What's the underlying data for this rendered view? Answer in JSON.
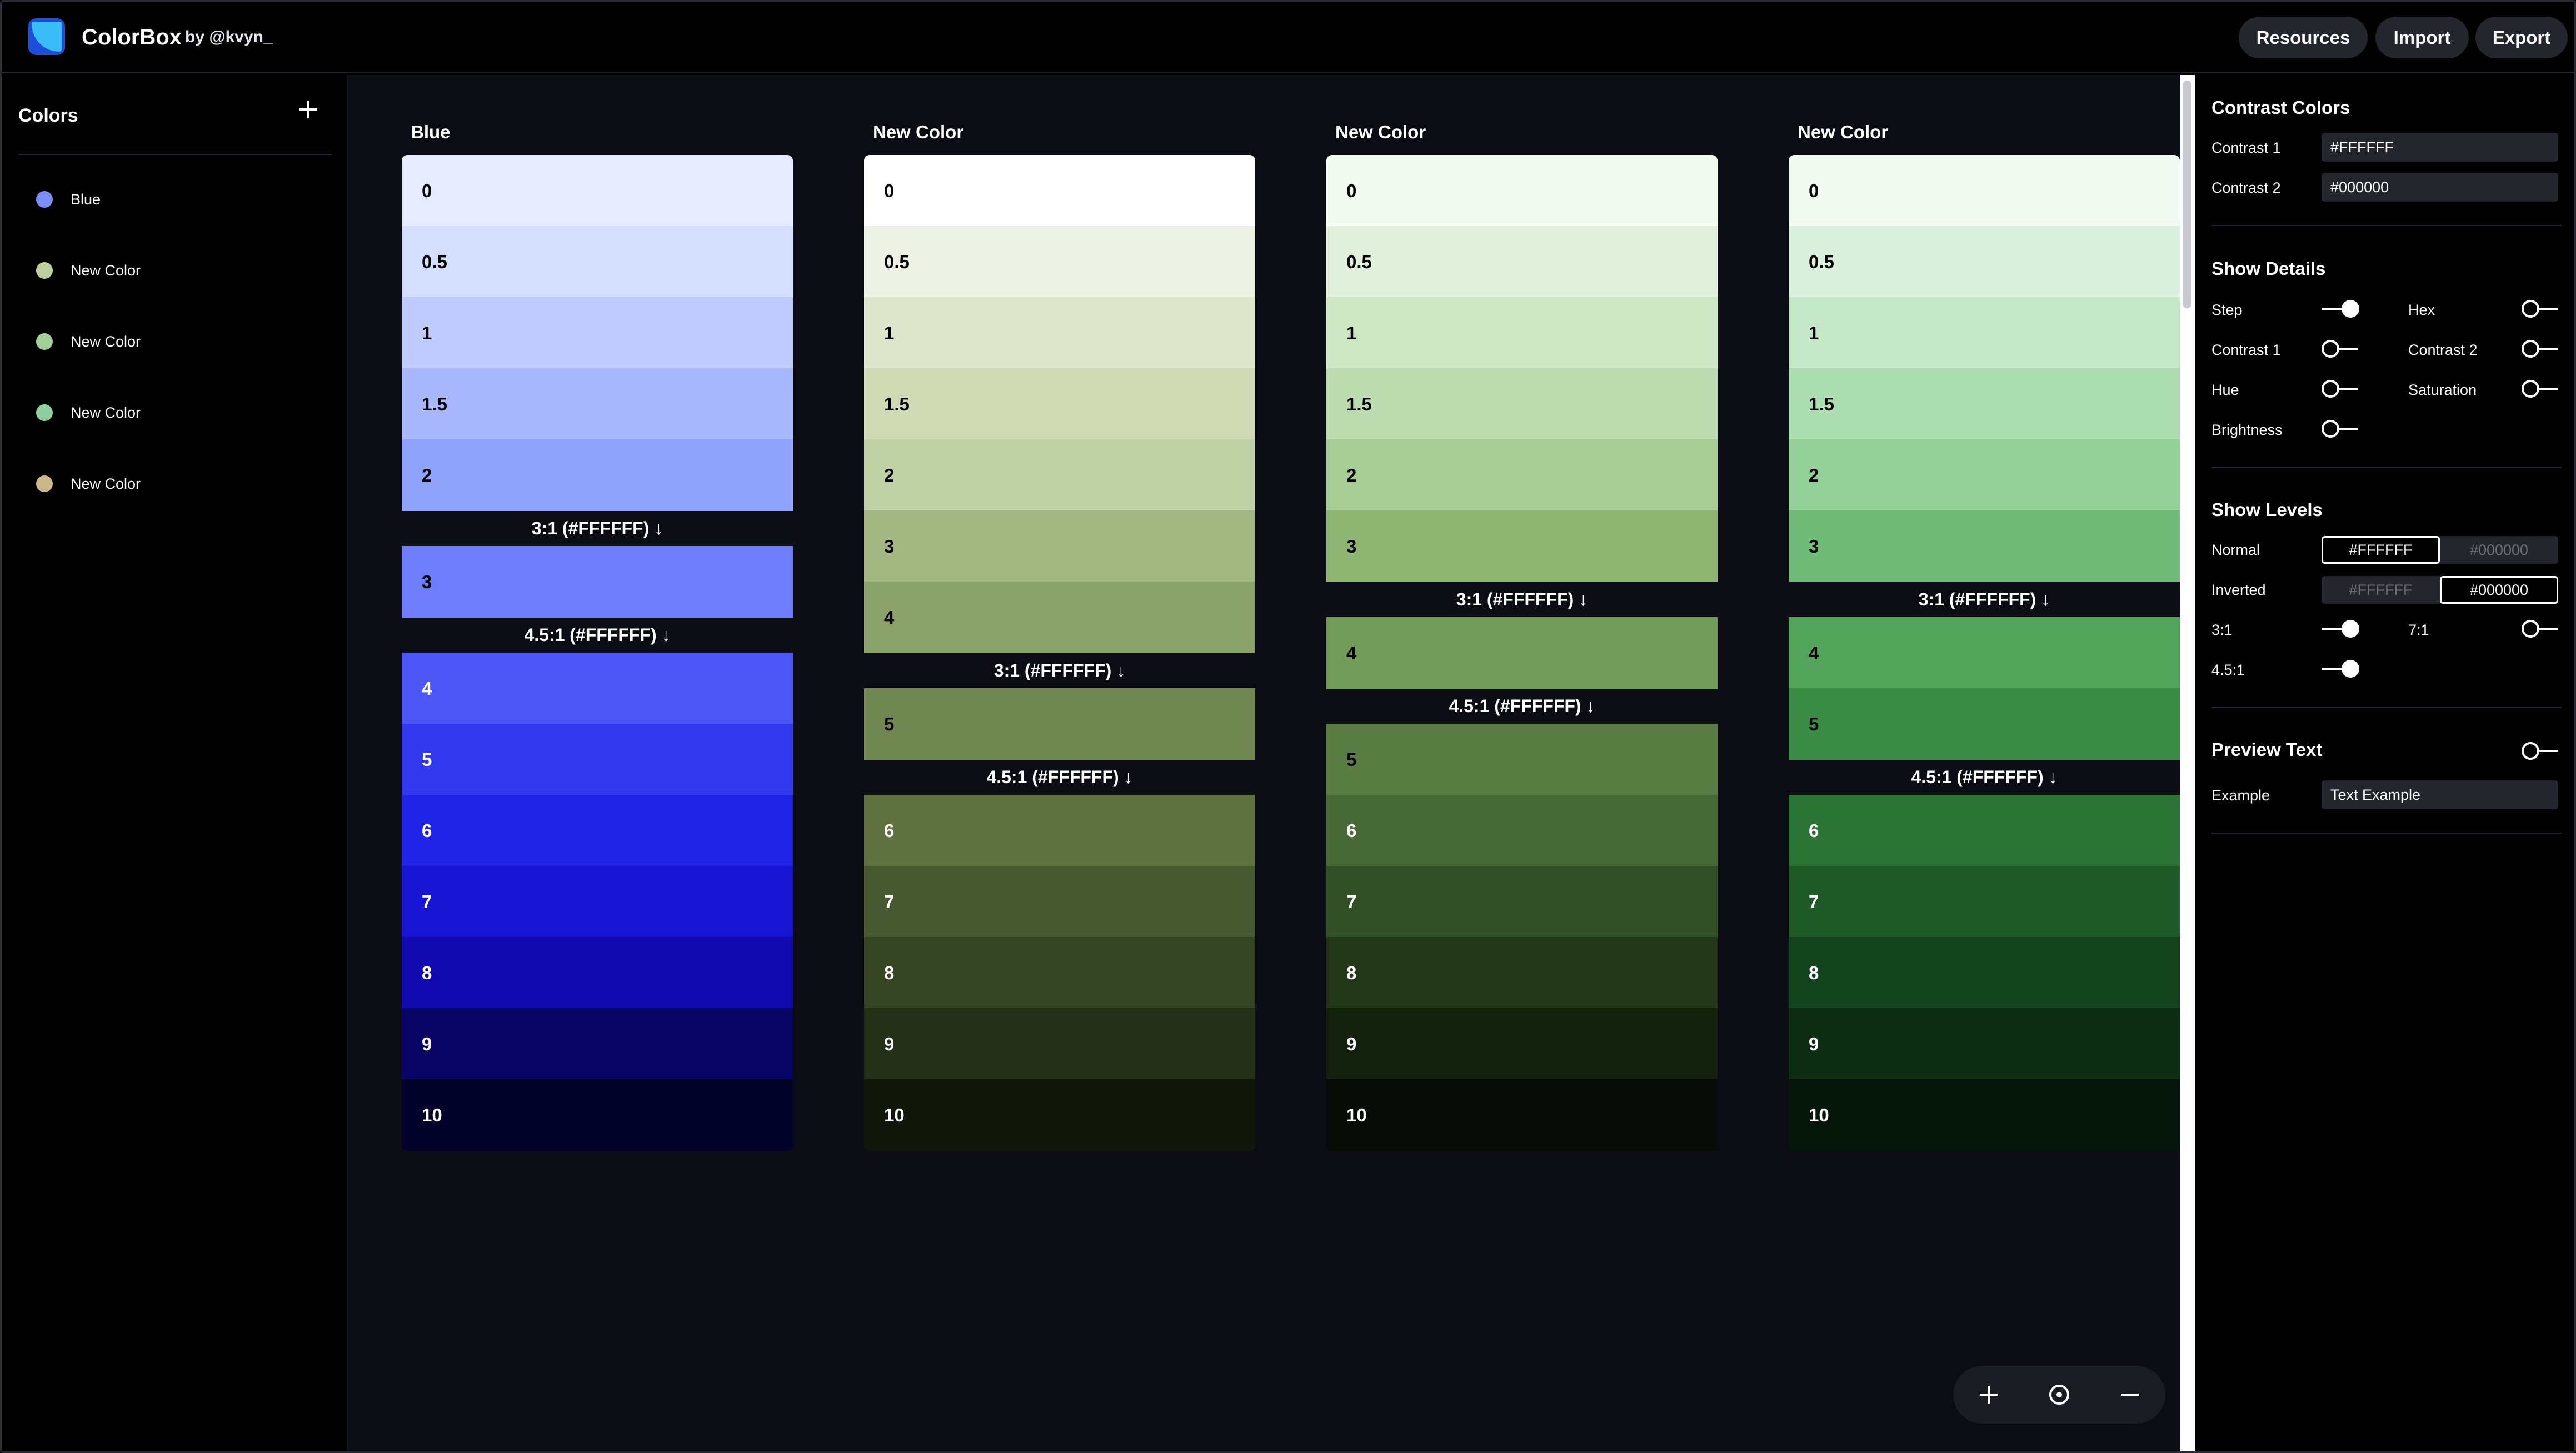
{
  "app": {
    "title": "ColorBox",
    "byline": "by @kvyn_",
    "buttons": [
      "Resources",
      "Import",
      "Export"
    ]
  },
  "sidebar": {
    "title": "Colors",
    "add_icon": "plus-icon",
    "items": [
      {
        "label": "Blue",
        "dot": "#7c8cf8"
      },
      {
        "label": "New Color",
        "dot": "#bfcfa0"
      },
      {
        "label": "New Color",
        "dot": "#a3cf98"
      },
      {
        "label": "New Color",
        "dot": "#8fd19e"
      },
      {
        "label": "New Color",
        "dot": "#cdb88a"
      }
    ]
  },
  "palettes": [
    {
      "title": "Blue",
      "steps": [
        {
          "label": "0",
          "color": "#e6ebff",
          "text": "#000000"
        },
        {
          "label": "0.5",
          "color": "#d4deff",
          "text": "#000000"
        },
        {
          "label": "1",
          "color": "#bfcbff",
          "text": "#000000"
        },
        {
          "label": "1.5",
          "color": "#a9b8fd",
          "text": "#000000"
        },
        {
          "label": "2",
          "color": "#90a4fc",
          "text": "#000000"
        },
        {
          "label": "3",
          "color": "#6e7dfc",
          "text": "#000000"
        },
        {
          "label": "4",
          "color": "#4c55f6",
          "text": "#ffffff"
        },
        {
          "label": "5",
          "color": "#3238ee",
          "text": "#ffffff"
        },
        {
          "label": "6",
          "color": "#2024e6",
          "text": "#ffffff"
        },
        {
          "label": "7",
          "color": "#1714d4",
          "text": "#ffffff"
        },
        {
          "label": "8",
          "color": "#1208b0",
          "text": "#ffffff"
        },
        {
          "label": "9",
          "color": "#080565",
          "text": "#ffffff"
        },
        {
          "label": "10",
          "color": "#03022b",
          "text": "#ffffff"
        }
      ],
      "levels": [
        {
          "before_index": 5,
          "label": "3:1 (#FFFFFF) ↓"
        },
        {
          "before_index": 6,
          "label": "4.5:1 (#FFFFFF) ↓"
        }
      ]
    },
    {
      "title": "New Color",
      "steps": [
        {
          "label": "0",
          "color": "#ffffff",
          "text": "#000000"
        },
        {
          "label": "0.5",
          "color": "#ecf1e4",
          "text": "#000000"
        },
        {
          "label": "1",
          "color": "#dde5cb",
          "text": "#000000"
        },
        {
          "label": "1.5",
          "color": "#cfdab5",
          "text": "#000000"
        },
        {
          "label": "2",
          "color": "#c1d1a6",
          "text": "#000000"
        },
        {
          "label": "3",
          "color": "#a3b783",
          "text": "#000000"
        },
        {
          "label": "4",
          "color": "#8aa16a",
          "text": "#000000"
        },
        {
          "label": "5",
          "color": "#718751",
          "text": "#000000"
        },
        {
          "label": "6",
          "color": "#5e713f",
          "text": "#ffffff"
        },
        {
          "label": "7",
          "color": "#475931",
          "text": "#ffffff"
        },
        {
          "label": "8",
          "color": "#354524",
          "text": "#ffffff"
        },
        {
          "label": "9",
          "color": "#242f17",
          "text": "#ffffff"
        },
        {
          "label": "10",
          "color": "#12170c",
          "text": "#ffffff"
        }
      ],
      "levels": [
        {
          "before_index": 7,
          "label": "3:1 (#FFFFFF) ↓"
        },
        {
          "before_index": 8,
          "label": "4.5:1 (#FFFFFF) ↓"
        }
      ]
    },
    {
      "title": "New Color",
      "steps": [
        {
          "label": "0",
          "color": "#f2fbef",
          "text": "#000000"
        },
        {
          "label": "0.5",
          "color": "#e0f0da",
          "text": "#000000"
        },
        {
          "label": "1",
          "color": "#cde6c3",
          "text": "#000000"
        },
        {
          "label": "1.5",
          "color": "#bcdcb0",
          "text": "#000000"
        },
        {
          "label": "2",
          "color": "#a9ce95",
          "text": "#000000"
        },
        {
          "label": "3",
          "color": "#8eb572",
          "text": "#000000"
        },
        {
          "label": "4",
          "color": "#729a58",
          "text": "#000000"
        },
        {
          "label": "5",
          "color": "#5a7d43",
          "text": "#000000"
        },
        {
          "label": "6",
          "color": "#456834",
          "text": "#ffffff"
        },
        {
          "label": "7",
          "color": "#325026",
          "text": "#ffffff"
        },
        {
          "label": "8",
          "color": "#223718",
          "text": "#ffffff"
        },
        {
          "label": "9",
          "color": "#13210c",
          "text": "#ffffff"
        },
        {
          "label": "10",
          "color": "#070b05",
          "text": "#ffffff"
        }
      ],
      "levels": [
        {
          "before_index": 6,
          "label": "3:1 (#FFFFFF) ↓"
        },
        {
          "before_index": 7,
          "label": "4.5:1 (#FFFFFF) ↓"
        }
      ]
    },
    {
      "title": "New Color",
      "steps": [
        {
          "label": "0",
          "color": "#f1fbf2",
          "text": "#000000"
        },
        {
          "label": "0.5",
          "color": "#dcf1dd",
          "text": "#000000"
        },
        {
          "label": "1",
          "color": "#c4e8c8",
          "text": "#000000"
        },
        {
          "label": "1.5",
          "color": "#acdeb1",
          "text": "#000000"
        },
        {
          "label": "2",
          "color": "#94d198",
          "text": "#000000"
        },
        {
          "label": "3",
          "color": "#70bb77",
          "text": "#000000"
        },
        {
          "label": "4",
          "color": "#51a45a",
          "text": "#000000"
        },
        {
          "label": "5",
          "color": "#3b8c44",
          "text": "#000000"
        },
        {
          "label": "6",
          "color": "#2b7335",
          "text": "#ffffff"
        },
        {
          "label": "7",
          "color": "#1e5b28",
          "text": "#ffffff"
        },
        {
          "label": "8",
          "color": "#14441d",
          "text": "#ffffff"
        },
        {
          "label": "9",
          "color": "#0c2d12",
          "text": "#ffffff"
        },
        {
          "label": "10",
          "color": "#05170a",
          "text": "#ffffff"
        }
      ],
      "levels": [
        {
          "before_index": 6,
          "label": "3:1 (#FFFFFF) ↓"
        },
        {
          "before_index": 8,
          "label": "4.5:1 (#FFFFFF) ↓"
        }
      ]
    }
  ],
  "zoom": {
    "zoom_in_icon": "plus-icon",
    "reset_icon": "target-icon",
    "zoom_out_icon": "minus-icon"
  },
  "panel": {
    "contrast": {
      "title": "Contrast Colors",
      "c1_label": "Contrast 1",
      "c1_value": "#FFFFFF",
      "c2_label": "Contrast 2",
      "c2_value": "#000000"
    },
    "details": {
      "title": "Show Details",
      "toggles": [
        {
          "label": "Step",
          "on": true
        },
        {
          "label": "Hex",
          "on": false
        },
        {
          "label": "Contrast 1",
          "on": false
        },
        {
          "label": "Contrast 2",
          "on": false
        },
        {
          "label": "Hue",
          "on": false
        },
        {
          "label": "Saturation",
          "on": false
        },
        {
          "label": "Brightness",
          "on": false
        }
      ]
    },
    "levels": {
      "title": "Show Levels",
      "normal_label": "Normal",
      "normal_options": [
        "#FFFFFF",
        "#000000"
      ],
      "normal_selected": 0,
      "inverted_label": "Inverted",
      "inverted_options": [
        "#FFFFFF",
        "#000000"
      ],
      "inverted_selected": 1,
      "toggles": [
        {
          "label": "3:1",
          "on": true
        },
        {
          "label": "7:1",
          "on": false
        },
        {
          "label": "4.5:1",
          "on": true
        }
      ]
    },
    "preview": {
      "title": "Preview Text",
      "on": false,
      "example_label": "Example",
      "example_value": "Text Example"
    }
  }
}
